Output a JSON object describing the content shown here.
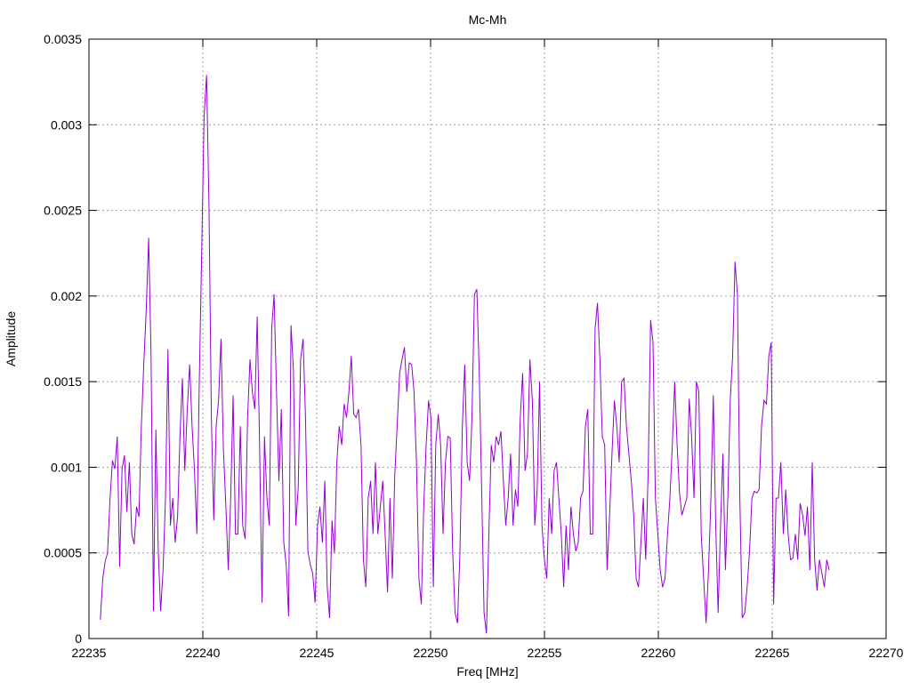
{
  "chart_data": {
    "type": "line",
    "title": "Mc-Mh",
    "xlabel": "Freq [MHz]",
    "ylabel": "Amplitude",
    "xlim": [
      22235,
      22270
    ],
    "ylim": [
      0,
      0.0035
    ],
    "xticks": [
      "22235",
      "22240",
      "22245",
      "22250",
      "22255",
      "22260",
      "22265",
      "22270"
    ],
    "yticks": [
      "0",
      "0.0005",
      "0.001",
      "0.0015",
      "0.002",
      "0.0025",
      "0.003",
      "0.0035"
    ],
    "grid": true,
    "legend": "none",
    "series": [
      {
        "name": "Mc-Mh",
        "color": "#9400d3",
        "x_start": 22235.5,
        "x_end": 22267.5,
        "y": [
          0.00011,
          0.00035,
          0.00045,
          0.0005,
          0.00082,
          0.00104,
          0.00099,
          0.00118,
          0.00042,
          0.00099,
          0.00107,
          0.00074,
          0.00103,
          0.00061,
          0.00055,
          0.00077,
          0.00071,
          0.00124,
          0.0016,
          0.00191,
          0.00234,
          0.00165,
          0.00016,
          0.00122,
          0.00051,
          0.00016,
          0.0004,
          0.00082,
          0.00169,
          0.00066,
          0.00082,
          0.00056,
          0.00071,
          0.00118,
          0.00152,
          0.00098,
          0.00134,
          0.0016,
          0.00124,
          0.00098,
          0.00061,
          0.0015,
          0.00225,
          0.00305,
          0.00329,
          0.00253,
          0.00129,
          0.00069,
          0.00124,
          0.00139,
          0.00175,
          0.00111,
          0.00077,
          0.0004,
          0.00082,
          0.00142,
          0.00061,
          0.00061,
          0.00124,
          0.00066,
          0.00058,
          0.00129,
          0.00163,
          0.00144,
          0.00134,
          0.00188,
          0.00113,
          0.00021,
          0.00118,
          0.00082,
          0.00066,
          0.00181,
          0.00201,
          0.00144,
          0.00092,
          0.00134,
          0.00056,
          0.00043,
          0.00013,
          0.00183,
          0.00157,
          0.00066,
          0.00088,
          0.00163,
          0.00175,
          0.00129,
          0.00051,
          0.00043,
          0.00038,
          0.00021,
          0.00066,
          0.00077,
          0.00056,
          0.00092,
          0.0003,
          0.00012,
          0.00069,
          0.0005,
          0.00103,
          0.00124,
          0.00113,
          0.00137,
          0.00129,
          0.00144,
          0.00165,
          0.00131,
          0.00129,
          0.00134,
          0.00113,
          0.00046,
          0.0003,
          0.00082,
          0.00092,
          0.00061,
          0.00103,
          0.00061,
          0.00077,
          0.00092,
          0.00061,
          0.00027,
          0.00082,
          0.00035,
          0.00095,
          0.00124,
          0.00155,
          0.00163,
          0.0017,
          0.00144,
          0.00161,
          0.0016,
          0.00144,
          0.00103,
          0.00035,
          0.0002,
          0.00077,
          0.00113,
          0.00139,
          0.00129,
          0.0003,
          0.00113,
          0.00131,
          0.00113,
          0.00061,
          0.00103,
          0.00118,
          0.00117,
          0.00051,
          0.00015,
          9e-05,
          0.00051,
          0.00124,
          0.0016,
          0.00103,
          0.00092,
          0.00129,
          0.00201,
          0.00204,
          0.00155,
          0.00087,
          0.00015,
          3e-05,
          0.00061,
          0.00113,
          0.00103,
          0.00118,
          0.00113,
          0.00121,
          0.00092,
          0.00066,
          0.00082,
          0.00108,
          0.00066,
          0.00087,
          0.00077,
          0.00129,
          0.00155,
          0.00098,
          0.00108,
          0.00163,
          0.00139,
          0.00066,
          0.00087,
          0.0015,
          0.00066,
          0.00046,
          0.00035,
          0.00082,
          0.00061,
          0.00098,
          0.00103,
          0.00082,
          0.00061,
          0.0003,
          0.00066,
          0.0004,
          0.00077,
          0.00061,
          0.00051,
          0.00056,
          0.00082,
          0.00086,
          0.00124,
          0.00134,
          0.00061,
          0.00061,
          0.00181,
          0.00196,
          0.00163,
          0.00118,
          0.00113,
          0.0004,
          0.00072,
          0.00108,
          0.00139,
          0.00124,
          0.00103,
          0.0015,
          0.00152,
          0.00124,
          0.00108,
          0.00092,
          0.00072,
          0.00035,
          0.0003,
          0.00056,
          0.00082,
          0.00046,
          0.00098,
          0.00186,
          0.00173,
          0.00082,
          0.00061,
          0.0004,
          0.0003,
          0.00035,
          0.00061,
          0.00082,
          0.00113,
          0.0015,
          0.00113,
          0.00085,
          0.00072,
          0.00077,
          0.00082,
          0.0014,
          0.00118,
          0.00082,
          0.0015,
          0.00144,
          0.00061,
          0.00035,
          9e-05,
          0.0004,
          0.00082,
          0.00142,
          0.00066,
          0.00015,
          0.00066,
          0.00108,
          0.0004,
          0.00082,
          0.00139,
          0.00165,
          0.0022,
          0.00201,
          0.00082,
          0.00012,
          0.00015,
          0.0003,
          0.00051,
          0.00082,
          0.00086,
          0.00085,
          0.00087,
          0.00124,
          0.00139,
          0.00137,
          0.00165,
          0.00173,
          0.0002,
          0.00082,
          0.00082,
          0.00103,
          0.00061,
          0.00087,
          0.00061,
          0.00046,
          0.00047,
          0.00061,
          0.00046,
          0.00079,
          0.00072,
          0.0006,
          0.00077,
          0.0004,
          0.00103,
          0.00046,
          0.00028,
          0.00046,
          0.00038,
          0.0003,
          0.00046,
          0.0004
        ]
      }
    ]
  }
}
